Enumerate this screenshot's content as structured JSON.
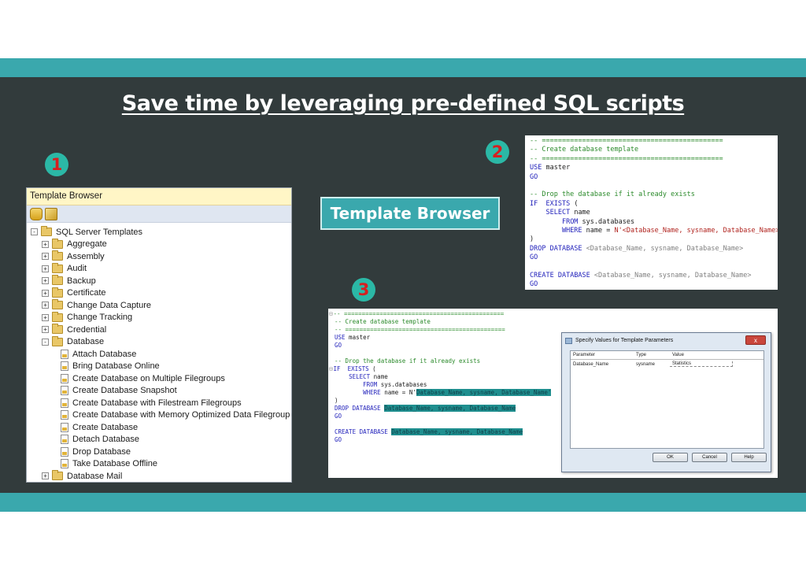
{
  "slide": {
    "title": "Save time by leveraging pre-defined SQL scripts",
    "button_label": "Template Browser",
    "badges": [
      "1",
      "2",
      "3"
    ],
    "colors": {
      "accent": "#3aa8ad",
      "panel": "#323b3c",
      "badge_fill": "#2bb8a6",
      "badge_text": "#d61f1f"
    }
  },
  "template_browser": {
    "header": "Template Browser",
    "toolbar_icons": [
      "database-icon",
      "cube-icon"
    ],
    "root": "SQL Server Templates",
    "folders_before": [
      "Aggregate",
      "Assembly",
      "Audit",
      "Backup",
      "Certificate",
      "Change Data Capture",
      "Change Tracking",
      "Credential"
    ],
    "expanded": "Database",
    "database_items": [
      "Attach Database",
      "Bring Database Online",
      "Create Database on Multiple Filegroups",
      "Create Database Snapshot",
      "Create Database with Filestream Filegroups",
      "Create Database with Memory Optimized Data Filegroup",
      "Create Database",
      "Detach Database",
      "Drop Database",
      "Take Database Offline"
    ],
    "folders_after": [
      "Database Mail"
    ]
  },
  "code_panel_2": {
    "lines": [
      "-- =============================================",
      "-- Create database template",
      "-- =============================================",
      "USE master",
      "GO",
      "",
      "-- Drop the database if it already exists",
      "IF  EXISTS (",
      "    SELECT name",
      "        FROM sys.databases",
      "        WHERE name = N'<Database_Name, sysname, Database_Name>'",
      ")",
      "DROP DATABASE <Database_Name, sysname, Database_Name>",
      "GO",
      "",
      "CREATE DATABASE <Database_Name, sysname, Database_Name>",
      "GO"
    ]
  },
  "code_panel_3": {
    "lines": [
      "-- =============================================",
      "-- Create database template",
      "-- =============================================",
      "USE master",
      "GO",
      "",
      "-- Drop the database if it already exists",
      "IF  EXISTS (",
      "    SELECT name",
      "        FROM sys.databases",
      "        WHERE name = N'",
      ")",
      "DROP DATABASE ",
      "GO",
      "",
      "CREATE DATABASE ",
      "GO"
    ],
    "highlight_text": "Database_Name, sysname, Database_Name",
    "highlight_text_quoted": "Database_Name, sysname, Database_Name'"
  },
  "dialog": {
    "title": "Specify Values for Template Parameters",
    "close_label": "x",
    "columns": [
      "Parameter",
      "Type",
      "Value"
    ],
    "rows": [
      {
        "parameter": "Database_Name",
        "type": "sysname",
        "value": "Statistics"
      }
    ],
    "buttons": [
      "OK",
      "Cancel",
      "Help"
    ]
  }
}
